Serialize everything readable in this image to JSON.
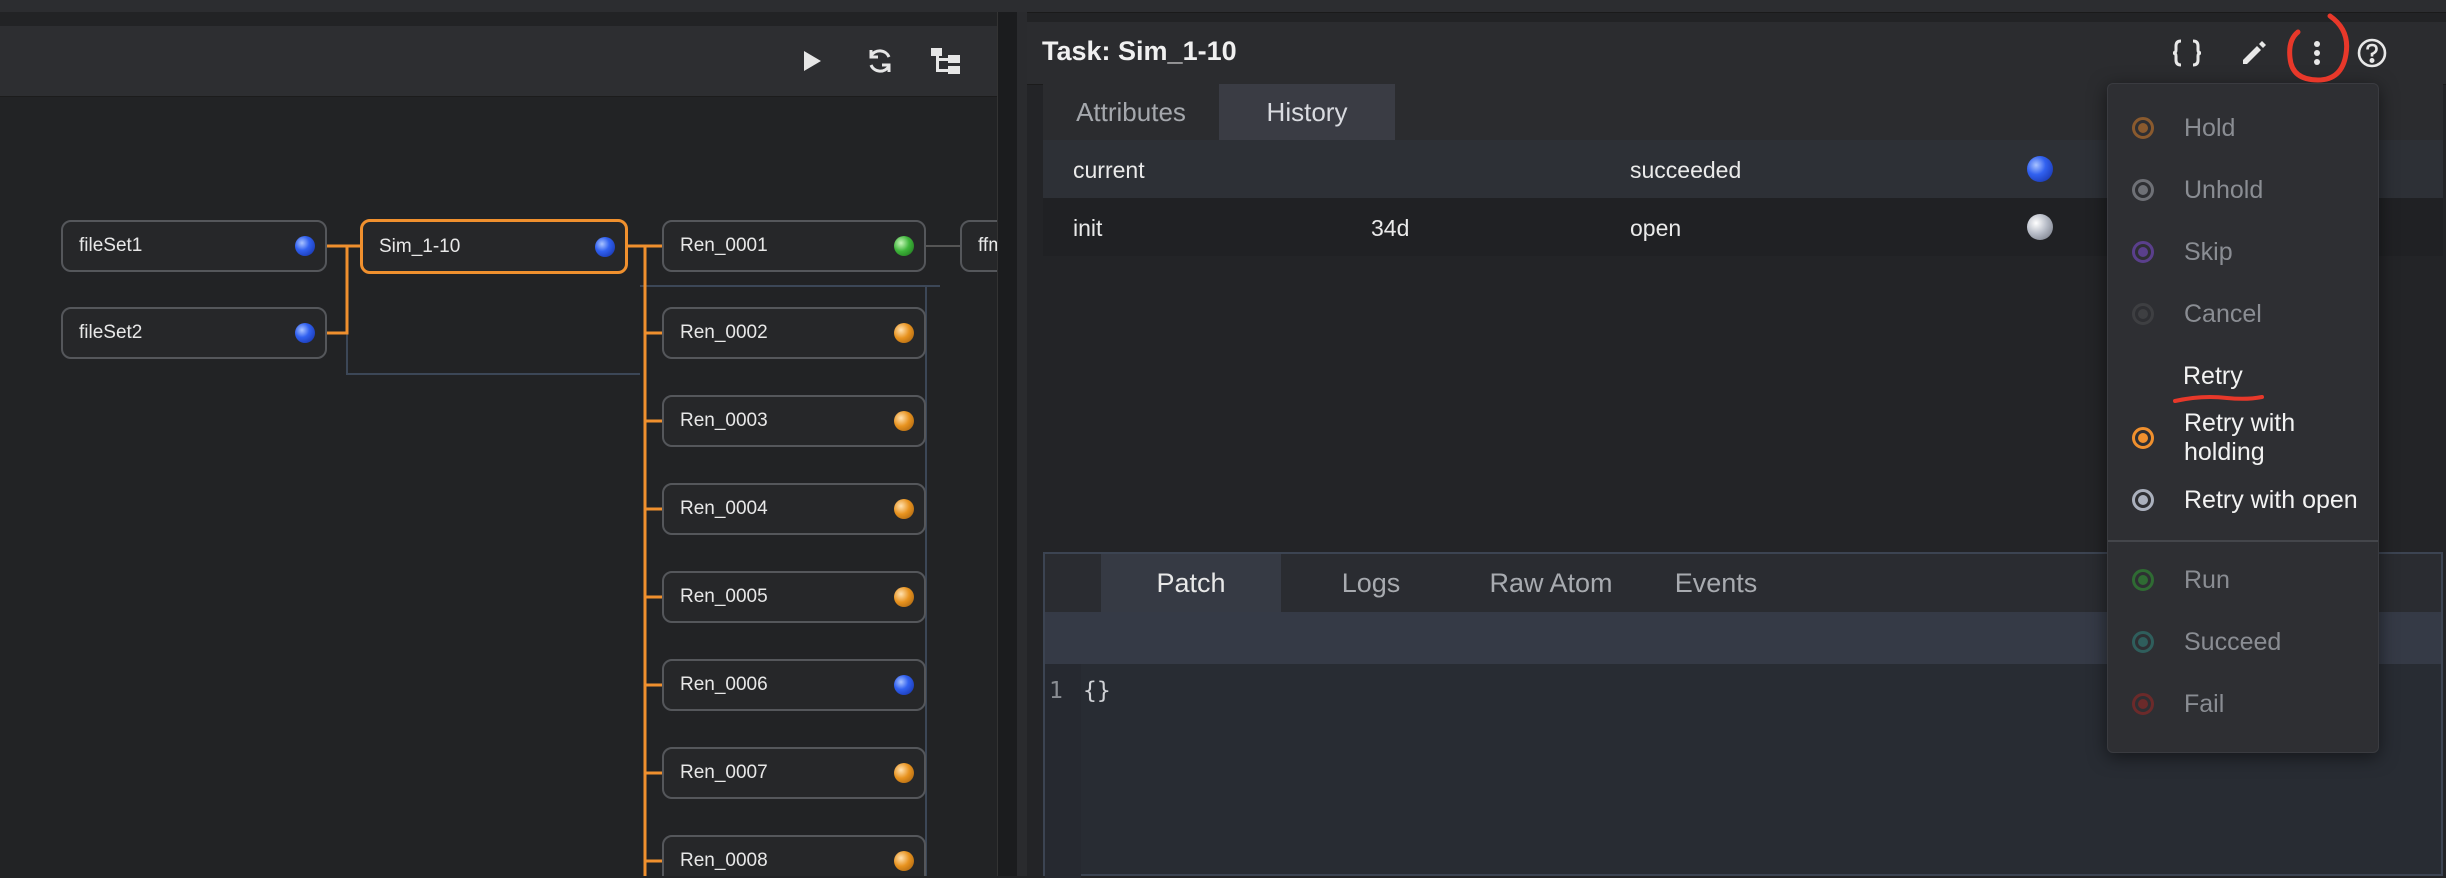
{
  "left_panel": {
    "toolbar": {
      "play_icon": "play-icon",
      "refresh_icon": "refresh-icon",
      "layout_icon": "tree-layout-icon"
    },
    "nodes": [
      {
        "label": "fileSet1",
        "status_color": "blue"
      },
      {
        "label": "fileSet2",
        "status_color": "blue"
      },
      {
        "label": "Sim_1-10",
        "status_color": "blue",
        "selected": true
      },
      {
        "label": "Ren_0001",
        "status_color": "green"
      },
      {
        "label": "Ren_0002",
        "status_color": "orange"
      },
      {
        "label": "Ren_0003",
        "status_color": "orange"
      },
      {
        "label": "Ren_0004",
        "status_color": "orange"
      },
      {
        "label": "Ren_0005",
        "status_color": "orange"
      },
      {
        "label": "Ren_0006",
        "status_color": "blue"
      },
      {
        "label": "Ren_0007",
        "status_color": "orange"
      },
      {
        "label": "Ren_0008",
        "status_color": "orange"
      },
      {
        "label": "ffm",
        "status_color": ""
      }
    ]
  },
  "task_panel": {
    "title": "Task: Sim_1-10",
    "header_icons": [
      "braces-icon",
      "pencil-icon",
      "more-vertical-icon",
      "help-icon"
    ],
    "tabs": [
      {
        "label": "Attributes",
        "active": false
      },
      {
        "label": "History",
        "active": true
      }
    ],
    "history_rows": [
      {
        "name": "current",
        "age": "",
        "state": "succeeded",
        "status_color": "blue"
      },
      {
        "name": "init",
        "age": "34d",
        "state": "open",
        "status_color": "grey"
      }
    ],
    "bottom_tabs": [
      {
        "label": "Patch",
        "active": true
      },
      {
        "label": "Logs",
        "active": false
      },
      {
        "label": "Raw Atom",
        "active": false
      },
      {
        "label": "Events",
        "active": false
      }
    ],
    "editor": {
      "line_number": "1",
      "content": "{}"
    }
  },
  "action_menu": {
    "items": [
      {
        "label": "Hold",
        "color": "#8a5a2e",
        "enabled": false
      },
      {
        "label": "Unhold",
        "color": "#6e7076",
        "enabled": false
      },
      {
        "label": "Skip",
        "color": "#5a3f8c",
        "enabled": false
      },
      {
        "label": "Cancel",
        "color": "#3e3f42",
        "enabled": false
      },
      {
        "label": "Retry",
        "color": "",
        "enabled": true
      },
      {
        "label": "Retry with holding",
        "color": "#f0902e",
        "enabled": true
      },
      {
        "label": "Retry with open",
        "color": "#aab0bd",
        "enabled": true
      },
      {
        "label": "Run",
        "color": "#2f6b33",
        "enabled": false
      },
      {
        "label": "Succeed",
        "color": "#2f5e5c",
        "enabled": false
      },
      {
        "label": "Fail",
        "color": "#6b2a2a",
        "enabled": false
      }
    ]
  },
  "colors": {
    "selection_orange": "#f0902e",
    "annotation_red": "#e8382a"
  }
}
